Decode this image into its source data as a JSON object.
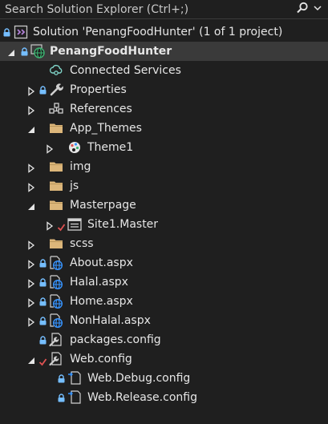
{
  "search": {
    "placeholder": "Search Solution Explorer (Ctrl+;)"
  },
  "solution": {
    "label": "Solution 'PenangFoodHunter' (1 of 1 project)"
  },
  "project": {
    "label": "PenangFoodHunter"
  },
  "items": {
    "connected": "Connected Services",
    "properties": "Properties",
    "references": "References",
    "app_themes": "App_Themes",
    "theme1": "Theme1",
    "img": "img",
    "js": "js",
    "masterpage": "Masterpage",
    "site1": "Site1.Master",
    "scss": "scss",
    "about": "About.aspx",
    "halal": "Halal.aspx",
    "home": "Home.aspx",
    "nonhalal": "NonHalal.aspx",
    "packages": "packages.config",
    "webconfig": "Web.config",
    "webdebug": "Web.Debug.config",
    "webrelease": "Web.Release.config"
  },
  "colors": {
    "background": "#1f1f1f",
    "selected_row": "#3a3a3a",
    "folder": "#dcb67a",
    "lock": "#75beff",
    "checkmark": "#e05252",
    "globe": "#3794ff",
    "project_green": "#3cb371",
    "solution_purple": "#b180d7"
  }
}
